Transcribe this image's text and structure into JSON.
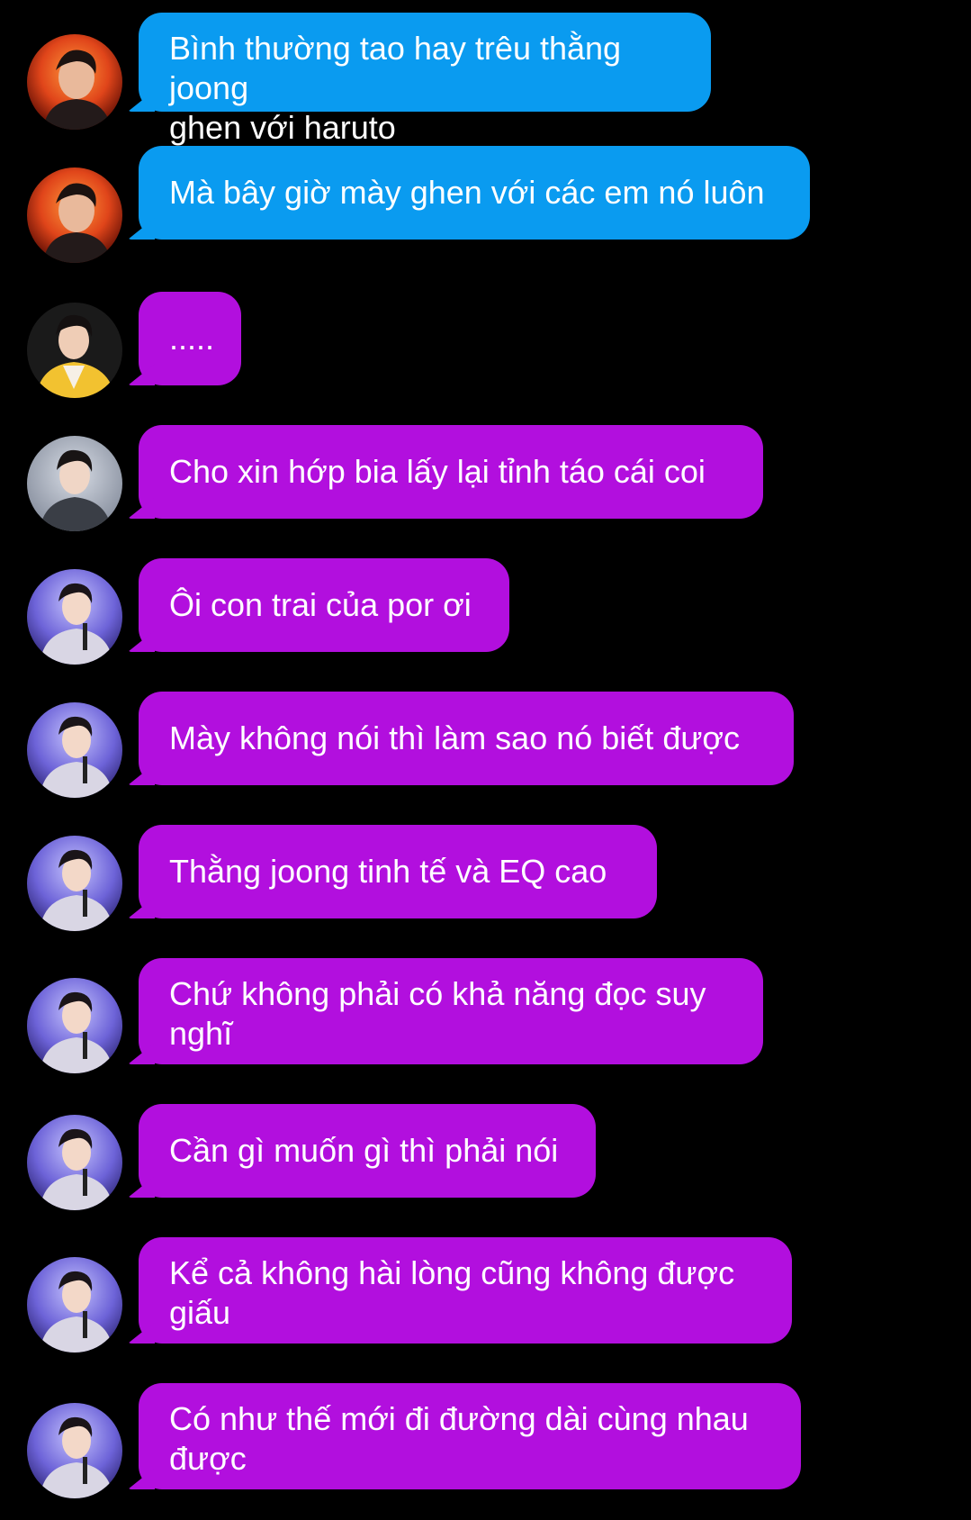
{
  "colors": {
    "background": "#000000",
    "blue_bubble": "#0A9BF0",
    "purple_bubble": "#B20FDE",
    "text": "#FFFFFF"
  },
  "messages": [
    {
      "text": "Bình thường tao hay trêu thằng joong\nghen với haruto",
      "bubble": "blue",
      "avatar": "red-avatar-icon"
    },
    {
      "text": "Mà bây giờ mày ghen với các em nó luôn",
      "bubble": "blue",
      "avatar": "red-avatar-icon"
    },
    {
      "text": ".....",
      "bubble": "purple",
      "avatar": "yellow-jacket-avatar-icon"
    },
    {
      "text": "Cho xin hớp bia lấy lại tỉnh táo cái coi",
      "bubble": "purple",
      "avatar": "gray-avatar-icon"
    },
    {
      "text": "Ôi con trai của por ơi",
      "bubble": "purple",
      "avatar": "stage-avatar-icon"
    },
    {
      "text": "Mày không nói thì làm sao nó biết được",
      "bubble": "purple",
      "avatar": "stage-avatar-icon"
    },
    {
      "text": "Thằng joong tinh tế và EQ cao",
      "bubble": "purple",
      "avatar": "stage-avatar-icon"
    },
    {
      "text": "Chứ không phải có khả năng đọc suy\nnghĩ",
      "bubble": "purple",
      "avatar": "stage-avatar-icon"
    },
    {
      "text": "Cần gì muốn gì thì phải nói",
      "bubble": "purple",
      "avatar": "stage-avatar-icon"
    },
    {
      "text": "Kể cả không hài lòng cũng không được\ngiấu",
      "bubble": "purple",
      "avatar": "stage-avatar-icon"
    },
    {
      "text": "Có như thế mới đi đường dài cùng nhau\nđược",
      "bubble": "purple",
      "avatar": "stage-avatar-icon"
    }
  ]
}
